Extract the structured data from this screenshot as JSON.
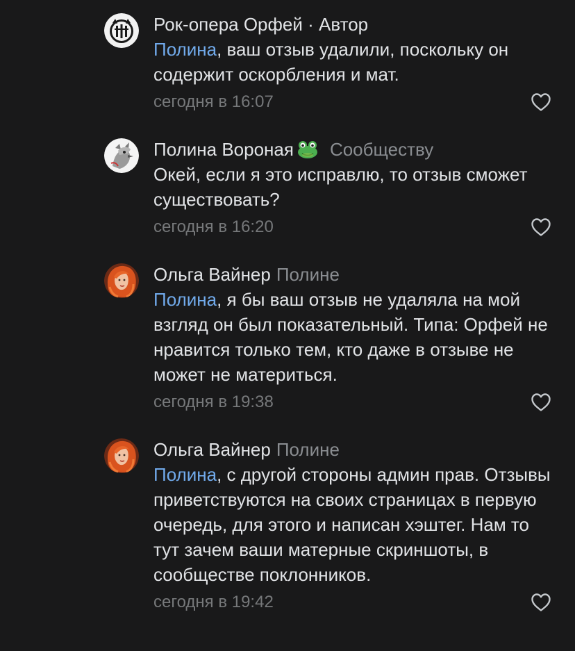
{
  "comments": [
    {
      "author": "Рок-опера Орфей",
      "separator": " · ",
      "role": "Автор",
      "mention": "Полина",
      "text": ", ваш отзыв удалили, поскольку он содержит оскорбления и мат.",
      "time": "сегодня в 16:07",
      "avatar_icon": "orpheus-logo-icon"
    },
    {
      "author": "Полина Вороная",
      "badge_icon": "frog-emoji-icon",
      "reply_to": "Сообществу",
      "text": "Окей, если я это исправлю, то отзыв сможет существовать?",
      "time": "сегодня в 16:20",
      "avatar_icon": "gray-cartoon-avatar"
    },
    {
      "author": "Ольга Вайнер",
      "reply_to": "Полине",
      "mention": "Полина",
      "text": ", я бы ваш отзыв не удаляла на мой взгляд он был показательный. Типа: Орфей не нравится только тем, кто даже в отзыве не может не материться.",
      "time": "сегодня в 19:38",
      "avatar_icon": "red-hair-avatar"
    },
    {
      "author": "Ольга Вайнер",
      "reply_to": "Полине",
      "mention": "Полина",
      "text": ", с другой стороны админ прав. Отзывы приветствуются на своих страницах в первую очередь, для этого и написан хэштег. Нам то тут зачем ваши матерные скриншоты, в сообществе поклонников.",
      "time": "сегодня в 19:42",
      "avatar_icon": "red-hair-avatar"
    }
  ],
  "colors": {
    "background": "#19191a",
    "text": "#e1e3e6",
    "mention": "#71aaeb",
    "muted": "#76787a",
    "reply_to": "#8a8d91"
  }
}
